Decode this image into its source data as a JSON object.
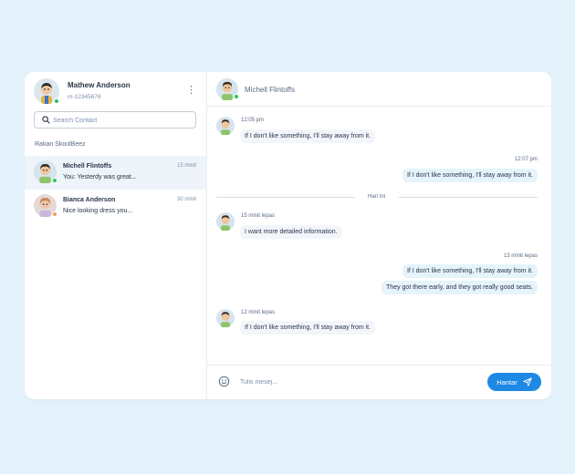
{
  "profile": {
    "name": "Mathew Anderson",
    "id": "m-12345678",
    "status_color": "#22c55e"
  },
  "search": {
    "placeholder": "Search Contact",
    "value": ""
  },
  "sidebar": {
    "group_label": "Rakan SkoolBeez",
    "contacts": [
      {
        "name": "Michell Flintoffs",
        "preview": "You: Yesterdy was great...",
        "time": "15 minit",
        "active": true,
        "status_color": "#22c55e"
      },
      {
        "name": "Bianca Anderson",
        "preview": "Nice looking dress you...",
        "time": "30 minit",
        "active": false,
        "status_color": "#f59e5b"
      }
    ]
  },
  "chat": {
    "contact_name": "Michell Flintoffs",
    "messages": [
      {
        "direction": "in",
        "time": "12:05 pm",
        "texts": [
          "If I don't like something, I'll stay away from it."
        ]
      },
      {
        "direction": "out",
        "time": "12:07 pm",
        "texts": [
          "If I don't like something, I'll stay away from it."
        ]
      },
      {
        "divider": "Hari Ini"
      },
      {
        "direction": "in",
        "time": "15 minit lepas",
        "texts": [
          "I want more detailed information."
        ]
      },
      {
        "direction": "out",
        "time": "13 minit lepas",
        "texts": [
          "If I don't like something, I'll stay away from it.",
          "They got there early, and they got really good seats."
        ]
      },
      {
        "direction": "in",
        "time": "12 minit lepas",
        "texts": [
          "If I don't like something, I'll stay away from it."
        ]
      }
    ]
  },
  "composer": {
    "placeholder": "Tulis mesej...",
    "value": "",
    "send_label": "Hantar"
  },
  "colors": {
    "accent": "#1e88e5",
    "online": "#22c55e",
    "away": "#f59e5b",
    "page_bg": "#e3f1fa"
  },
  "icons": {
    "menu": "kebab-icon",
    "search": "search-icon",
    "emoji": "emoji-icon",
    "send": "send-icon"
  }
}
